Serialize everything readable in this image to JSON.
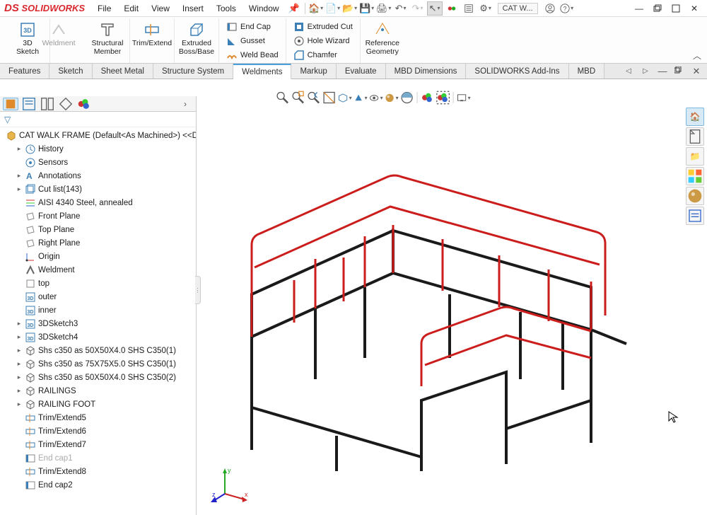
{
  "app": {
    "logo": "SOLIDWORKS",
    "doc_name": "CAT W..."
  },
  "menu": [
    "File",
    "Edit",
    "View",
    "Insert",
    "Tools",
    "Window"
  ],
  "ribbon": {
    "big": [
      {
        "label": "3D\nSketch",
        "icon": "3d-sketch"
      },
      {
        "label": "Weldment",
        "icon": "weldment",
        "disabled": true
      },
      {
        "label": "Structural\nMember",
        "icon": "structural"
      },
      {
        "label": "Trim/Extend",
        "icon": "trim"
      },
      {
        "label": "Extruded\nBoss/Base",
        "icon": "extrude"
      }
    ],
    "col1": [
      {
        "label": "End Cap",
        "icon": "endcap"
      },
      {
        "label": "Gusset",
        "icon": "gusset"
      },
      {
        "label": "Weld Bead",
        "icon": "weldbead"
      }
    ],
    "col2": [
      {
        "label": "Extruded Cut",
        "icon": "excut"
      },
      {
        "label": "Hole Wizard",
        "icon": "hole"
      },
      {
        "label": "Chamfer",
        "icon": "chamfer"
      }
    ],
    "ref": {
      "label": "Reference\nGeometry",
      "icon": "refgeom"
    }
  },
  "tabs": [
    "Features",
    "Sketch",
    "Sheet Metal",
    "Structure System",
    "Weldments",
    "Markup",
    "Evaluate",
    "MBD Dimensions",
    "SOLIDWORKS Add-Ins",
    "MBD"
  ],
  "active_tab": "Weldments",
  "tree": {
    "root": "CAT WALK FRAME (Default<As Machined>) <<De",
    "items": [
      {
        "label": "History",
        "icon": "history",
        "exp": true
      },
      {
        "label": "Sensors",
        "icon": "sensors"
      },
      {
        "label": "Annotations",
        "icon": "annot",
        "exp": true
      },
      {
        "label": "Cut list(143)",
        "icon": "cutlist",
        "exp": true
      },
      {
        "label": "AISI 4340 Steel, annealed",
        "icon": "material"
      },
      {
        "label": "Front Plane",
        "icon": "plane"
      },
      {
        "label": "Top Plane",
        "icon": "plane"
      },
      {
        "label": "Right Plane",
        "icon": "plane"
      },
      {
        "label": "Origin",
        "icon": "origin"
      },
      {
        "label": "Weldment",
        "icon": "weldfeat"
      },
      {
        "label": "top",
        "icon": "sketch2d"
      },
      {
        "label": "outer",
        "icon": "sketch3d"
      },
      {
        "label": "inner",
        "icon": "sketch3d"
      },
      {
        "label": "3DSketch3",
        "icon": "sketch3d",
        "exp": true
      },
      {
        "label": "3DSketch4",
        "icon": "sketch3d",
        "exp": true
      },
      {
        "label": "Shs c350 as 50X50X4.0 SHS C350(1)",
        "icon": "body",
        "exp": true
      },
      {
        "label": "Shs c350 as 75X75X5.0 SHS C350(1)",
        "icon": "body",
        "exp": true
      },
      {
        "label": "Shs c350 as 50X50X4.0 SHS C350(2)",
        "icon": "body",
        "exp": true
      },
      {
        "label": "RAILINGS",
        "icon": "body",
        "exp": true
      },
      {
        "label": "RAILING FOOT",
        "icon": "body",
        "exp": true
      },
      {
        "label": "Trim/Extend5",
        "icon": "trimfeat"
      },
      {
        "label": "Trim/Extend6",
        "icon": "trimfeat"
      },
      {
        "label": "Trim/Extend7",
        "icon": "trimfeat"
      },
      {
        "label": "End cap1",
        "icon": "endcapfeat",
        "dim": true
      },
      {
        "label": "Trim/Extend8",
        "icon": "trimfeat"
      },
      {
        "label": "End cap2",
        "icon": "endcapfeat"
      }
    ]
  },
  "triad": {
    "x": "x",
    "y": "y",
    "z": "z"
  }
}
